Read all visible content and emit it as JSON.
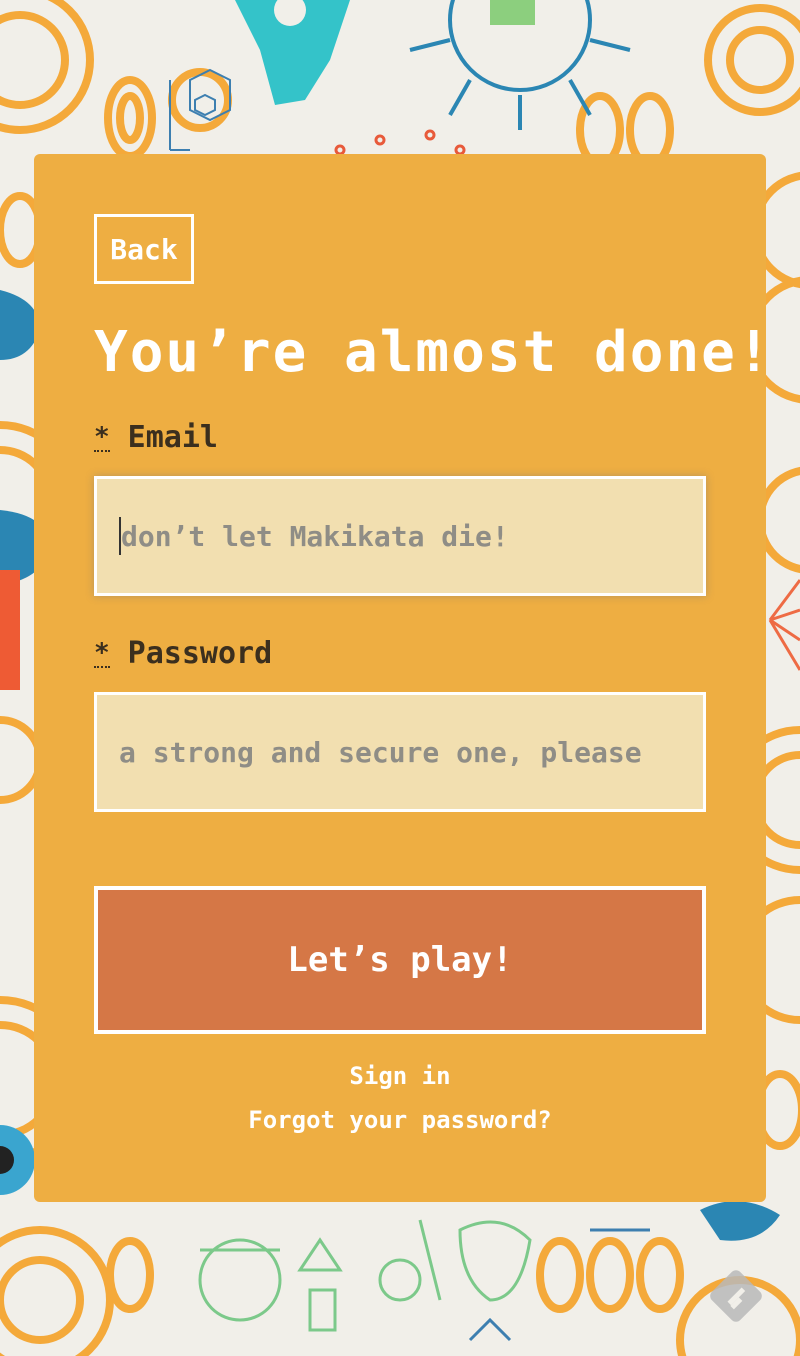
{
  "back_button": {
    "label": "Back"
  },
  "heading": "You’re almost done!",
  "form": {
    "email": {
      "required_mark": "*",
      "label": "Email",
      "placeholder": "don’t let Makikata die!"
    },
    "password": {
      "required_mark": "*",
      "label": "Password",
      "placeholder": "a strong and secure one, please"
    },
    "submit_label": "Let’s play!"
  },
  "links": {
    "sign_in": "Sign in",
    "forgot_password": "Forgot your password?"
  },
  "colors": {
    "card": "#eeae42",
    "input_bg": "#f2dfb0",
    "submit_bg": "#d57746",
    "background": "#f1efe9"
  }
}
